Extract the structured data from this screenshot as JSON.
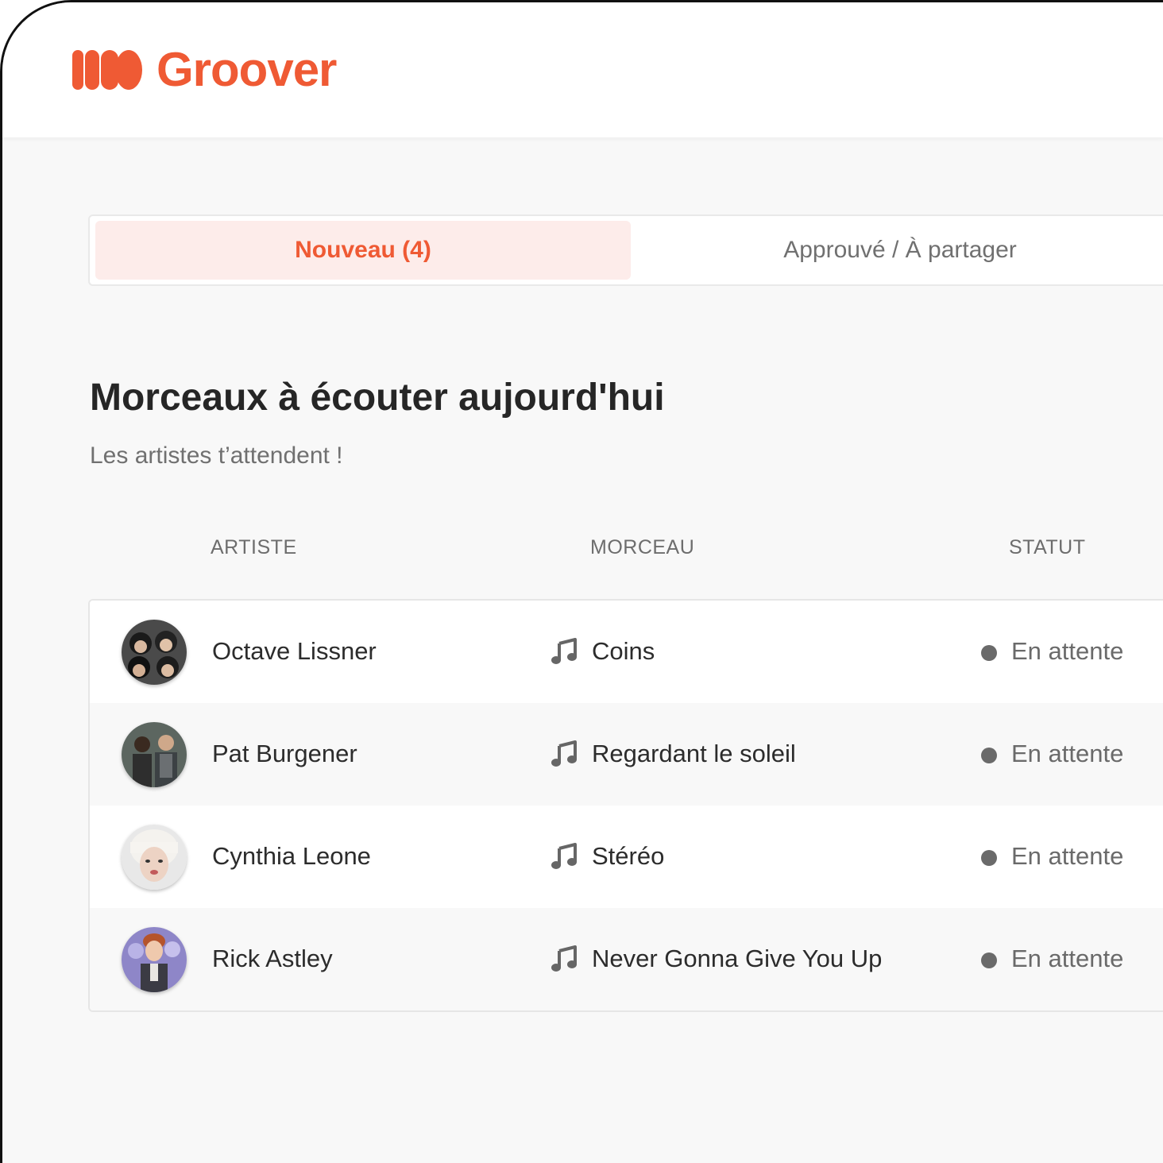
{
  "brand": {
    "name": "Groover",
    "accent": "#ef5a34"
  },
  "tabs": [
    {
      "label": "Nouveau (4)",
      "active": true
    },
    {
      "label": "Approuvé / À partager",
      "active": false
    }
  ],
  "section": {
    "title": "Morceaux à écouter aujourd'hui",
    "subtitle": "Les artistes t’attendent !"
  },
  "table": {
    "columns": [
      "ARTISTE",
      "MORCEAU",
      "STATUT"
    ],
    "rows": [
      {
        "artist": "Octave Lissner",
        "track": "Coins",
        "status": "En attente",
        "track_icon": "music-note-icon",
        "status_color": "#6a6a6a"
      },
      {
        "artist": "Pat Burgener",
        "track": "Regardant le soleil",
        "status": "En attente",
        "track_icon": "music-note-icon",
        "status_color": "#6a6a6a"
      },
      {
        "artist": "Cynthia Leone",
        "track": "Stéréo",
        "status": "En attente",
        "track_icon": "music-note-icon",
        "status_color": "#6a6a6a"
      },
      {
        "artist": "Rick Astley",
        "track": "Never Gonna Give You Up",
        "status": "En attente",
        "track_icon": "music-note-icon",
        "status_color": "#6a6a6a"
      }
    ]
  }
}
